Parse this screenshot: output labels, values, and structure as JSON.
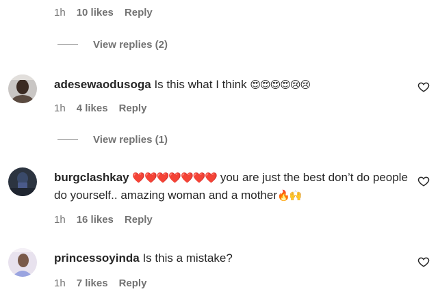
{
  "top_thread": {
    "time": "1h",
    "likes": "10 likes",
    "reply": "Reply",
    "view_replies": "View replies (2)"
  },
  "comments": [
    {
      "username": "adesewaodusoga",
      "text": "Is this what I think",
      "emojis": "😍😍😍😍😢😢",
      "time": "1h",
      "likes": "4 likes",
      "reply": "Reply",
      "view_replies": "View replies (1)"
    },
    {
      "username": "burgclashkay",
      "hearts": "❤️❤️❤️❤️❤️❤️❤️",
      "text": "you are just the best don’t do people do yourself.. amazing woman and a mother",
      "emojis": "🔥🙌",
      "time": "1h",
      "likes": "16 likes",
      "reply": "Reply"
    },
    {
      "username": "princessoyinda",
      "text": "Is this a mistake?",
      "time": "1h",
      "likes": "7 likes",
      "reply": "Reply"
    }
  ],
  "icons": {
    "like": "heart-outline-icon",
    "divider": "reply-line-icon"
  },
  "colors": {
    "text": "#262626",
    "meta": "#737373",
    "background": "#ffffff"
  }
}
